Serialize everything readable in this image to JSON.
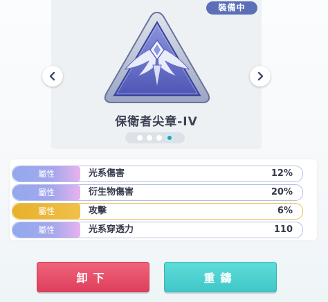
{
  "status_badge": "裝備中",
  "item_name": "保衛者尖章-IV",
  "carousel": {
    "total": 4,
    "active_index": 3
  },
  "stats": [
    {
      "tag": "屬性",
      "name": "光系傷害",
      "value": "12%",
      "highlight": false
    },
    {
      "tag": "屬性",
      "name": "衍生物傷害",
      "value": "20%",
      "highlight": false
    },
    {
      "tag": "屬性",
      "name": "攻擊",
      "value": "6%",
      "highlight": true
    },
    {
      "tag": "屬性",
      "name": "光系穿透力",
      "value": "110",
      "highlight": false
    }
  ],
  "buttons": {
    "unequip": "卸下",
    "recast": "重鑄"
  },
  "colors": {
    "badge": "#5b6fb8",
    "unequip": "#e04a64",
    "recast": "#4bd0cf",
    "highlight_stat": "#e8b02c"
  }
}
